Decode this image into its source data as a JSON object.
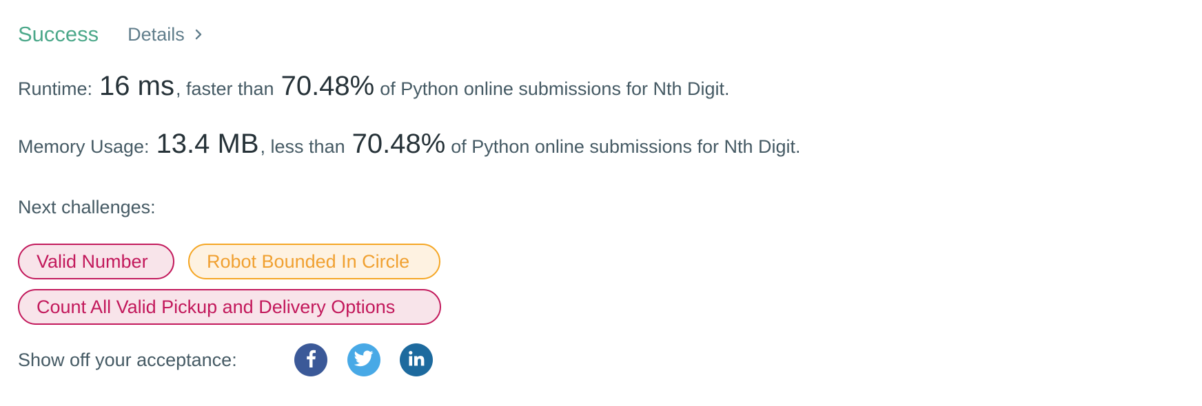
{
  "header": {
    "status": "Success",
    "details_label": "Details"
  },
  "runtime": {
    "label": "Runtime:",
    "value": "16 ms",
    "comparison": ", faster than",
    "percent": "70.48%",
    "suffix": "of Python online submissions for Nth Digit."
  },
  "memory": {
    "label": "Memory Usage:",
    "value": "13.4 MB",
    "comparison": ", less than",
    "percent": "70.48%",
    "suffix": "of Python online submissions for Nth Digit."
  },
  "next": {
    "label": "Next challenges:",
    "challenges": [
      {
        "title": "Valid Number",
        "difficulty_color": "#c2185b"
      },
      {
        "title": "Robot Bounded In Circle",
        "difficulty_color": "#f5a623"
      },
      {
        "title": "Count All Valid Pickup and Delivery Options",
        "difficulty_color": "#c2185b"
      }
    ]
  },
  "share": {
    "label": "Show off your acceptance:",
    "buttons": [
      {
        "icon": "facebook-icon",
        "color": "#3b5998"
      },
      {
        "icon": "twitter-icon",
        "color": "#48a9e6"
      },
      {
        "icon": "linkedin-icon",
        "color": "#1d6a9e"
      }
    ]
  },
  "colors": {
    "success": "#4ca88a",
    "text": "#455a64",
    "emphasis": "#263238"
  }
}
